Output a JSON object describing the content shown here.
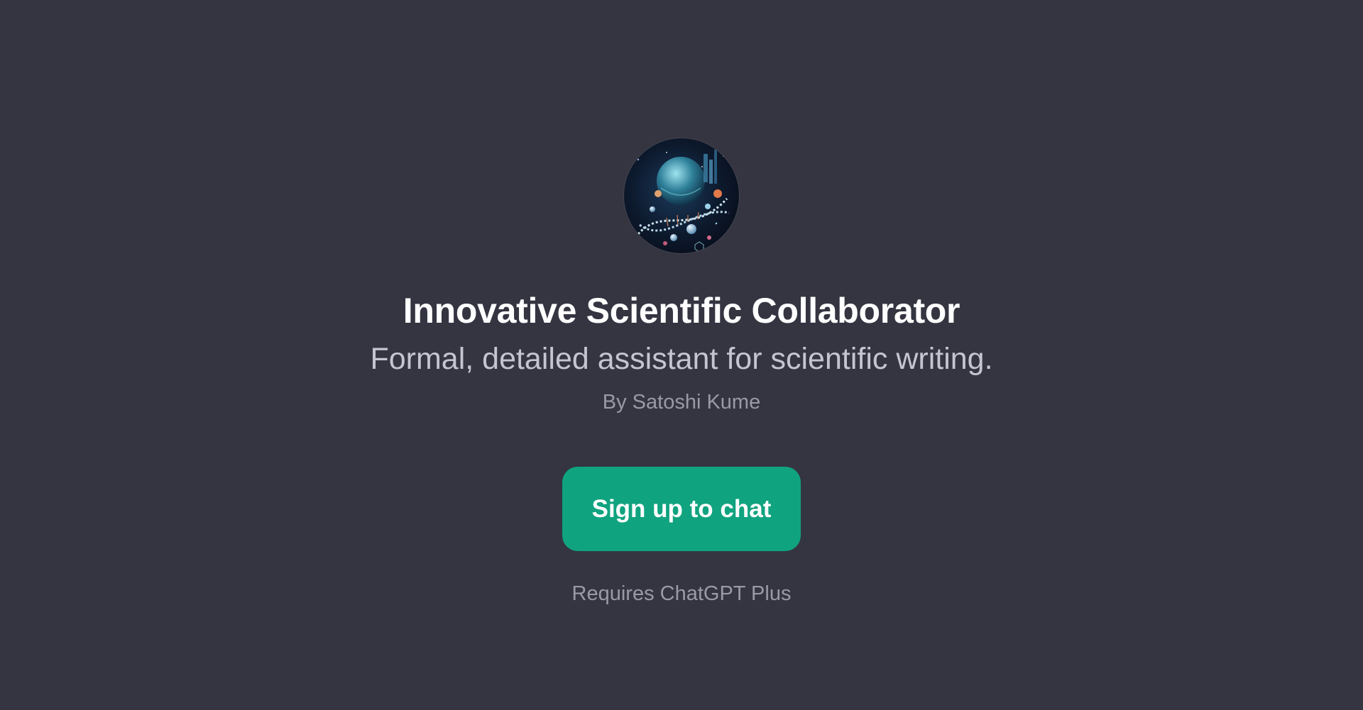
{
  "gpt": {
    "title": "Innovative Scientific Collaborator",
    "description": "Formal, detailed assistant for scientific writing.",
    "author": "By Satoshi Kume"
  },
  "cta": {
    "label": "Sign up to chat"
  },
  "footer": {
    "note": "Requires ChatGPT Plus"
  },
  "colors": {
    "background": "#343541",
    "button": "#10a37f",
    "title": "#ffffff",
    "subtitle": "#c5c5d2",
    "muted": "#9a9aa6"
  },
  "icons": {
    "avatar": "scientific-molecules-avatar-icon"
  }
}
